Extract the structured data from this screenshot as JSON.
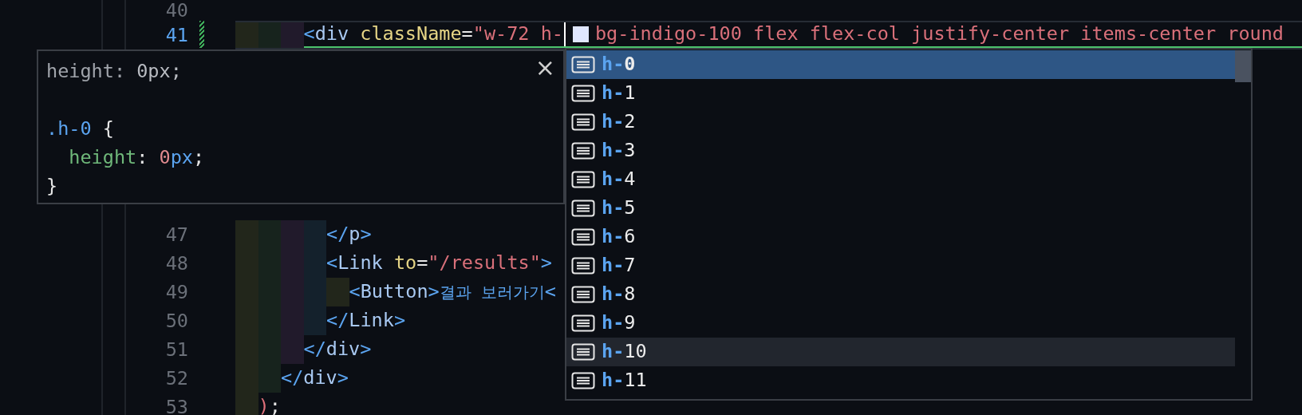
{
  "editor": {
    "lines": [
      {
        "number": "40",
        "current": false,
        "modified": false
      },
      {
        "number": "41",
        "current": true,
        "modified": true,
        "tokens": [
          {
            "kind": "bracket",
            "text": "      <"
          },
          {
            "kind": "tag",
            "text": "div"
          },
          {
            "kind": "attr",
            "text": " className"
          },
          {
            "kind": "punct",
            "text": "="
          },
          {
            "kind": "string",
            "text": "\"w-72 h-"
          },
          {
            "kind": "cursor"
          },
          {
            "kind": "swatch",
            "color": "#e0e7ff"
          },
          {
            "kind": "string",
            "text": "bg-indigo-100 flex flex-col justify-center items-center round"
          }
        ]
      },
      {
        "number": "47",
        "current": false,
        "modified": false,
        "tokens": [
          {
            "kind": "bracket",
            "text": "        </"
          },
          {
            "kind": "tag",
            "text": "p"
          },
          {
            "kind": "bracket",
            "text": ">"
          }
        ]
      },
      {
        "number": "48",
        "current": false,
        "modified": false,
        "tokens": [
          {
            "kind": "bracket",
            "text": "        <"
          },
          {
            "kind": "tag",
            "text": "Link"
          },
          {
            "kind": "attr",
            "text": " to"
          },
          {
            "kind": "punct",
            "text": "="
          },
          {
            "kind": "string",
            "text": "\"/results\""
          },
          {
            "kind": "bracket",
            "text": ">"
          }
        ]
      },
      {
        "number": "49",
        "current": false,
        "modified": false,
        "tokens": [
          {
            "kind": "bracket",
            "text": "          <"
          },
          {
            "kind": "tag",
            "text": "Button"
          },
          {
            "kind": "bracket",
            "text": ">"
          },
          {
            "kind": "content",
            "text": "결과 보러가기"
          },
          {
            "kind": "bracket",
            "text": "<"
          }
        ]
      },
      {
        "number": "50",
        "current": false,
        "modified": false,
        "tokens": [
          {
            "kind": "bracket",
            "text": "        </"
          },
          {
            "kind": "tag",
            "text": "Link"
          },
          {
            "kind": "bracket",
            "text": ">"
          }
        ]
      },
      {
        "number": "51",
        "current": false,
        "modified": false,
        "tokens": [
          {
            "kind": "bracket",
            "text": "      </"
          },
          {
            "kind": "tag",
            "text": "div"
          },
          {
            "kind": "bracket",
            "text": ">"
          }
        ]
      },
      {
        "number": "52",
        "current": false,
        "modified": false,
        "tokens": [
          {
            "kind": "bracket",
            "text": "    </"
          },
          {
            "kind": "tag",
            "text": "div"
          },
          {
            "kind": "bracket",
            "text": ">"
          }
        ]
      },
      {
        "number": "53",
        "current": false,
        "modified": false,
        "tokens": [
          {
            "kind": "paren",
            "text": "  )"
          },
          {
            "kind": "punct",
            "text": ";"
          }
        ]
      }
    ]
  },
  "hover": {
    "lines": [
      [
        {
          "kind": "muted",
          "text": "height: "
        },
        {
          "kind": "mutedvalue",
          "text": "0px;"
        }
      ],
      [
        {
          "kind": "selector",
          "text": ".h-0"
        },
        {
          "kind": "punct",
          "text": " {"
        }
      ],
      [
        {
          "kind": "property",
          "text": "  height"
        },
        {
          "kind": "punct",
          "text": ": "
        },
        {
          "kind": "number",
          "text": "0"
        },
        {
          "kind": "unit",
          "text": "px"
        },
        {
          "kind": "punct",
          "text": ";"
        }
      ],
      [
        {
          "kind": "punct",
          "text": "}"
        }
      ]
    ],
    "close": "×"
  },
  "suggestions": [
    {
      "match": "h-",
      "rest": "0",
      "selected": true,
      "hovered": false
    },
    {
      "match": "h-",
      "rest": "1",
      "selected": false,
      "hovered": false
    },
    {
      "match": "h-",
      "rest": "2",
      "selected": false,
      "hovered": false
    },
    {
      "match": "h-",
      "rest": "3",
      "selected": false,
      "hovered": false
    },
    {
      "match": "h-",
      "rest": "4",
      "selected": false,
      "hovered": false
    },
    {
      "match": "h-",
      "rest": "5",
      "selected": false,
      "hovered": false
    },
    {
      "match": "h-",
      "rest": "6",
      "selected": false,
      "hovered": false
    },
    {
      "match": "h-",
      "rest": "7",
      "selected": false,
      "hovered": false
    },
    {
      "match": "h-",
      "rest": "8",
      "selected": false,
      "hovered": false
    },
    {
      "match": "h-",
      "rest": "9",
      "selected": false,
      "hovered": false
    },
    {
      "match": "h-",
      "rest": "10",
      "selected": false,
      "hovered": true
    },
    {
      "match": "h-",
      "rest": "11",
      "selected": false,
      "hovered": false
    }
  ]
}
